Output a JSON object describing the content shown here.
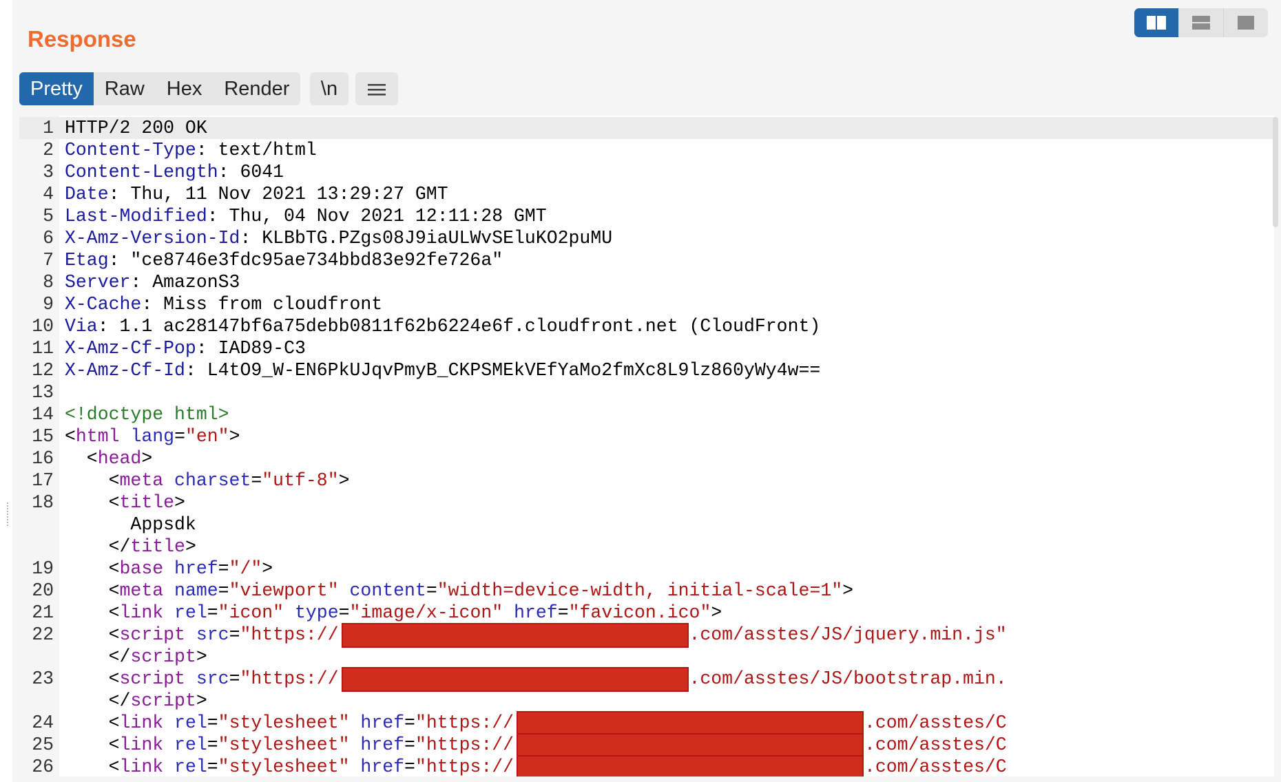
{
  "title": "Response",
  "layout_buttons": [
    {
      "icon": "split-columns-icon",
      "active": true
    },
    {
      "icon": "split-rows-icon",
      "active": false
    },
    {
      "icon": "single-pane-icon",
      "active": false
    }
  ],
  "tabs": [
    {
      "label": "Pretty",
      "active": true
    },
    {
      "label": "Raw",
      "active": false
    },
    {
      "label": "Hex",
      "active": false
    },
    {
      "label": "Render",
      "active": false
    }
  ],
  "newline_button": "\\n",
  "menu_icon": "hamburger-menu-icon",
  "colors": {
    "title": "#f26a2e",
    "active_tab": "#2468ac",
    "header_name": "#1a1a9a",
    "tag": "#8a1b97",
    "attribute_name": "#2a2ab8",
    "attribute_value": "#b01515",
    "doctype": "#2c7a2c",
    "redaction": "#d12d1f"
  },
  "lines": [
    {
      "n": "1",
      "tokens": [
        {
          "t": "HTTP/2 200 OK"
        }
      ]
    },
    {
      "n": "2",
      "tokens": [
        {
          "t": "Content-Type",
          "c": "hname"
        },
        {
          "t": ": text/html"
        }
      ]
    },
    {
      "n": "3",
      "tokens": [
        {
          "t": "Content-Length",
          "c": "hname"
        },
        {
          "t": ": 6041"
        }
      ]
    },
    {
      "n": "4",
      "tokens": [
        {
          "t": "Date",
          "c": "hname"
        },
        {
          "t": ": Thu, 11 Nov 2021 13:29:27 GMT"
        }
      ]
    },
    {
      "n": "5",
      "tokens": [
        {
          "t": "Last-Modified",
          "c": "hname"
        },
        {
          "t": ": Thu, 04 Nov 2021 12:11:28 GMT"
        }
      ]
    },
    {
      "n": "6",
      "tokens": [
        {
          "t": "X-Amz-Version-Id",
          "c": "hname"
        },
        {
          "t": ": KLBbTG.PZgs08J9iaULWvSEluKO2puMU"
        }
      ]
    },
    {
      "n": "7",
      "tokens": [
        {
          "t": "Etag",
          "c": "hname"
        },
        {
          "t": ": \"ce8746e3fdc95ae734bbd83e92fe726a\""
        }
      ]
    },
    {
      "n": "8",
      "tokens": [
        {
          "t": "Server",
          "c": "hname"
        },
        {
          "t": ": AmazonS3"
        }
      ]
    },
    {
      "n": "9",
      "tokens": [
        {
          "t": "X-Cache",
          "c": "hname"
        },
        {
          "t": ": Miss from cloudfront"
        }
      ]
    },
    {
      "n": "10",
      "tokens": [
        {
          "t": "Via",
          "c": "hname"
        },
        {
          "t": ": 1.1 ac28147bf6a75debb0811f62b6224e6f.cloudfront.net (CloudFront)"
        }
      ]
    },
    {
      "n": "11",
      "tokens": [
        {
          "t": "X-Amz-Cf-Pop",
          "c": "hname"
        },
        {
          "t": ": IAD89-C3"
        }
      ]
    },
    {
      "n": "12",
      "tokens": [
        {
          "t": "X-Amz-Cf-Id",
          "c": "hname"
        },
        {
          "t": ": L4tO9_W-EN6PkUJqvPmyB_CKPSMEkVEfYaMo2fmXc8L9lz860yWy4w=="
        }
      ]
    },
    {
      "n": "13",
      "tokens": []
    },
    {
      "n": "14",
      "tokens": [
        {
          "t": "<!doctype html>",
          "c": "doct"
        }
      ]
    },
    {
      "n": "15",
      "tokens": [
        {
          "t": "<"
        },
        {
          "t": "html",
          "c": "tagn"
        },
        {
          "t": " "
        },
        {
          "t": "lang",
          "c": "attrn"
        },
        {
          "t": "="
        },
        {
          "t": "\"en\"",
          "c": "attrv"
        },
        {
          "t": ">"
        }
      ]
    },
    {
      "n": "16",
      "tokens": [
        {
          "t": "  <"
        },
        {
          "t": "head",
          "c": "tagn"
        },
        {
          "t": ">"
        }
      ]
    },
    {
      "n": "17",
      "tokens": [
        {
          "t": "    <"
        },
        {
          "t": "meta",
          "c": "tagn"
        },
        {
          "t": " "
        },
        {
          "t": "charset",
          "c": "attrn"
        },
        {
          "t": "="
        },
        {
          "t": "\"utf-8\"",
          "c": "attrv"
        },
        {
          "t": ">"
        }
      ]
    },
    {
      "n": "18",
      "tokens": [
        {
          "t": "    <"
        },
        {
          "t": "title",
          "c": "tagn"
        },
        {
          "t": ">"
        }
      ]
    },
    {
      "n": "",
      "tokens": [
        {
          "t": "      Appsdk"
        }
      ]
    },
    {
      "n": "",
      "tokens": [
        {
          "t": "    </"
        },
        {
          "t": "title",
          "c": "tagn"
        },
        {
          "t": ">"
        }
      ]
    },
    {
      "n": "19",
      "tokens": [
        {
          "t": "    <"
        },
        {
          "t": "base",
          "c": "tagn"
        },
        {
          "t": " "
        },
        {
          "t": "href",
          "c": "attrn"
        },
        {
          "t": "="
        },
        {
          "t": "\"/\"",
          "c": "attrv"
        },
        {
          "t": ">"
        }
      ]
    },
    {
      "n": "20",
      "tokens": [
        {
          "t": "    <"
        },
        {
          "t": "meta",
          "c": "tagn"
        },
        {
          "t": " "
        },
        {
          "t": "name",
          "c": "attrn"
        },
        {
          "t": "="
        },
        {
          "t": "\"viewport\"",
          "c": "attrv"
        },
        {
          "t": " "
        },
        {
          "t": "content",
          "c": "attrn"
        },
        {
          "t": "="
        },
        {
          "t": "\"width=device-width, initial-scale=1\"",
          "c": "attrv"
        },
        {
          "t": ">"
        }
      ]
    },
    {
      "n": "21",
      "tokens": [
        {
          "t": "    <"
        },
        {
          "t": "link",
          "c": "tagn"
        },
        {
          "t": " "
        },
        {
          "t": "rel",
          "c": "attrn"
        },
        {
          "t": "="
        },
        {
          "t": "\"icon\"",
          "c": "attrv"
        },
        {
          "t": " "
        },
        {
          "t": "type",
          "c": "attrn"
        },
        {
          "t": "="
        },
        {
          "t": "\"image/x-icon\"",
          "c": "attrv"
        },
        {
          "t": " "
        },
        {
          "t": "href",
          "c": "attrn"
        },
        {
          "t": "="
        },
        {
          "t": "\"favicon.ico\"",
          "c": "attrv"
        },
        {
          "t": ">"
        }
      ]
    },
    {
      "n": "22",
      "tokens": [
        {
          "t": "    <"
        },
        {
          "t": "script",
          "c": "tagn"
        },
        {
          "t": " "
        },
        {
          "t": "src",
          "c": "attrn"
        },
        {
          "t": "="
        },
        {
          "t": "\"https://",
          "c": "attrv"
        },
        {
          "t": "                      ",
          "redact": true
        },
        {
          "t": ".amazonaws.com/asstes/JS/jquery.min.js\"",
          "c": "attrv"
        }
      ]
    },
    {
      "n": "",
      "tokens": [
        {
          "t": "    </"
        },
        {
          "t": "script",
          "c": "tagn"
        },
        {
          "t": ">"
        }
      ]
    },
    {
      "n": "23",
      "tokens": [
        {
          "t": "    <"
        },
        {
          "t": "script",
          "c": "tagn"
        },
        {
          "t": " "
        },
        {
          "t": "src",
          "c": "attrn"
        },
        {
          "t": "="
        },
        {
          "t": "\"https://",
          "c": "attrv"
        },
        {
          "t": "                      ",
          "redact": true
        },
        {
          "t": ".amazonaws.com/asstes/JS/bootstrap.min.",
          "c": "attrv"
        }
      ]
    },
    {
      "n": "",
      "tokens": [
        {
          "t": "    </"
        },
        {
          "t": "script",
          "c": "tagn"
        },
        {
          "t": ">"
        }
      ]
    },
    {
      "n": "24",
      "tokens": [
        {
          "t": "    <"
        },
        {
          "t": "link",
          "c": "tagn"
        },
        {
          "t": " "
        },
        {
          "t": "rel",
          "c": "attrn"
        },
        {
          "t": "="
        },
        {
          "t": "\"stylesheet\"",
          "c": "attrv"
        },
        {
          "t": " "
        },
        {
          "t": "href",
          "c": "attrn"
        },
        {
          "t": "="
        },
        {
          "t": "\"https://",
          "c": "attrv"
        },
        {
          "t": "                      ",
          "redact": true
        },
        {
          "t": ".amazonaws.com/asstes/C",
          "c": "attrv"
        }
      ]
    },
    {
      "n": "25",
      "tokens": [
        {
          "t": "    <"
        },
        {
          "t": "link",
          "c": "tagn"
        },
        {
          "t": " "
        },
        {
          "t": "rel",
          "c": "attrn"
        },
        {
          "t": "="
        },
        {
          "t": "\"stylesheet\"",
          "c": "attrv"
        },
        {
          "t": " "
        },
        {
          "t": "href",
          "c": "attrn"
        },
        {
          "t": "="
        },
        {
          "t": "\"https://",
          "c": "attrv"
        },
        {
          "t": "                      ",
          "redact": true
        },
        {
          "t": ".amazonaws.com/asstes/C",
          "c": "attrv"
        }
      ]
    },
    {
      "n": "26",
      "tokens": [
        {
          "t": "    <"
        },
        {
          "t": "link",
          "c": "tagn"
        },
        {
          "t": " "
        },
        {
          "t": "rel",
          "c": "attrn"
        },
        {
          "t": "="
        },
        {
          "t": "\"stylesheet\"",
          "c": "attrv"
        },
        {
          "t": " "
        },
        {
          "t": "href",
          "c": "attrn"
        },
        {
          "t": "="
        },
        {
          "t": "\"https://",
          "c": "attrv"
        },
        {
          "t": "                      ",
          "redact": true
        },
        {
          "t": ".amazonaws.com/asstes/C",
          "c": "attrv"
        }
      ]
    }
  ]
}
